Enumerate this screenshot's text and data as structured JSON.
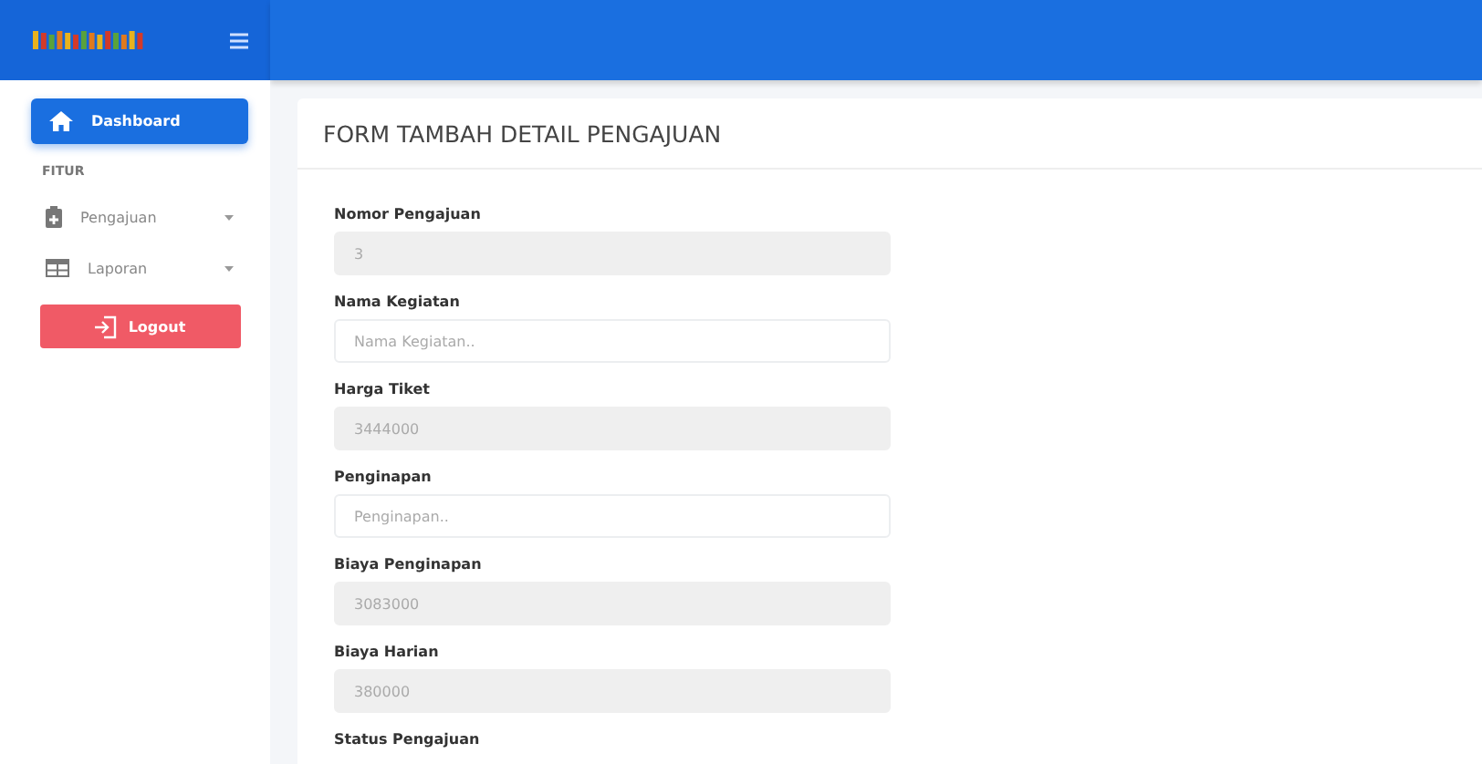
{
  "sidebar": {
    "items": [
      {
        "kind": "link",
        "label": "Dashboard",
        "selected": true
      },
      {
        "kind": "heading",
        "label": "FITUR"
      },
      {
        "kind": "menu",
        "label": "Pengajuan",
        "selected": false
      },
      {
        "kind": "menu",
        "label": "Laporan",
        "selected": false
      },
      {
        "kind": "logout",
        "label": "Logout"
      }
    ]
  },
  "card": {
    "title": "FORM TAMBAH DETAIL PENGAJUAN",
    "fields": [
      {
        "label": "Nomor Pengajuan",
        "value": "3",
        "disabled": true
      },
      {
        "label": "Nama Kegiatan",
        "placeholder": "Nama Kegiatan..",
        "disabled": false
      },
      {
        "label": "Harga Tiket",
        "value": "3444000",
        "disabled": true
      },
      {
        "label": "Penginapan",
        "placeholder": "Penginapan..",
        "disabled": false
      },
      {
        "label": "Biaya Penginapan",
        "value": "3083000",
        "disabled": true
      },
      {
        "label": "Biaya Harian",
        "value": "380000",
        "disabled": true
      },
      {
        "label": "Status Pengajuan"
      }
    ]
  }
}
